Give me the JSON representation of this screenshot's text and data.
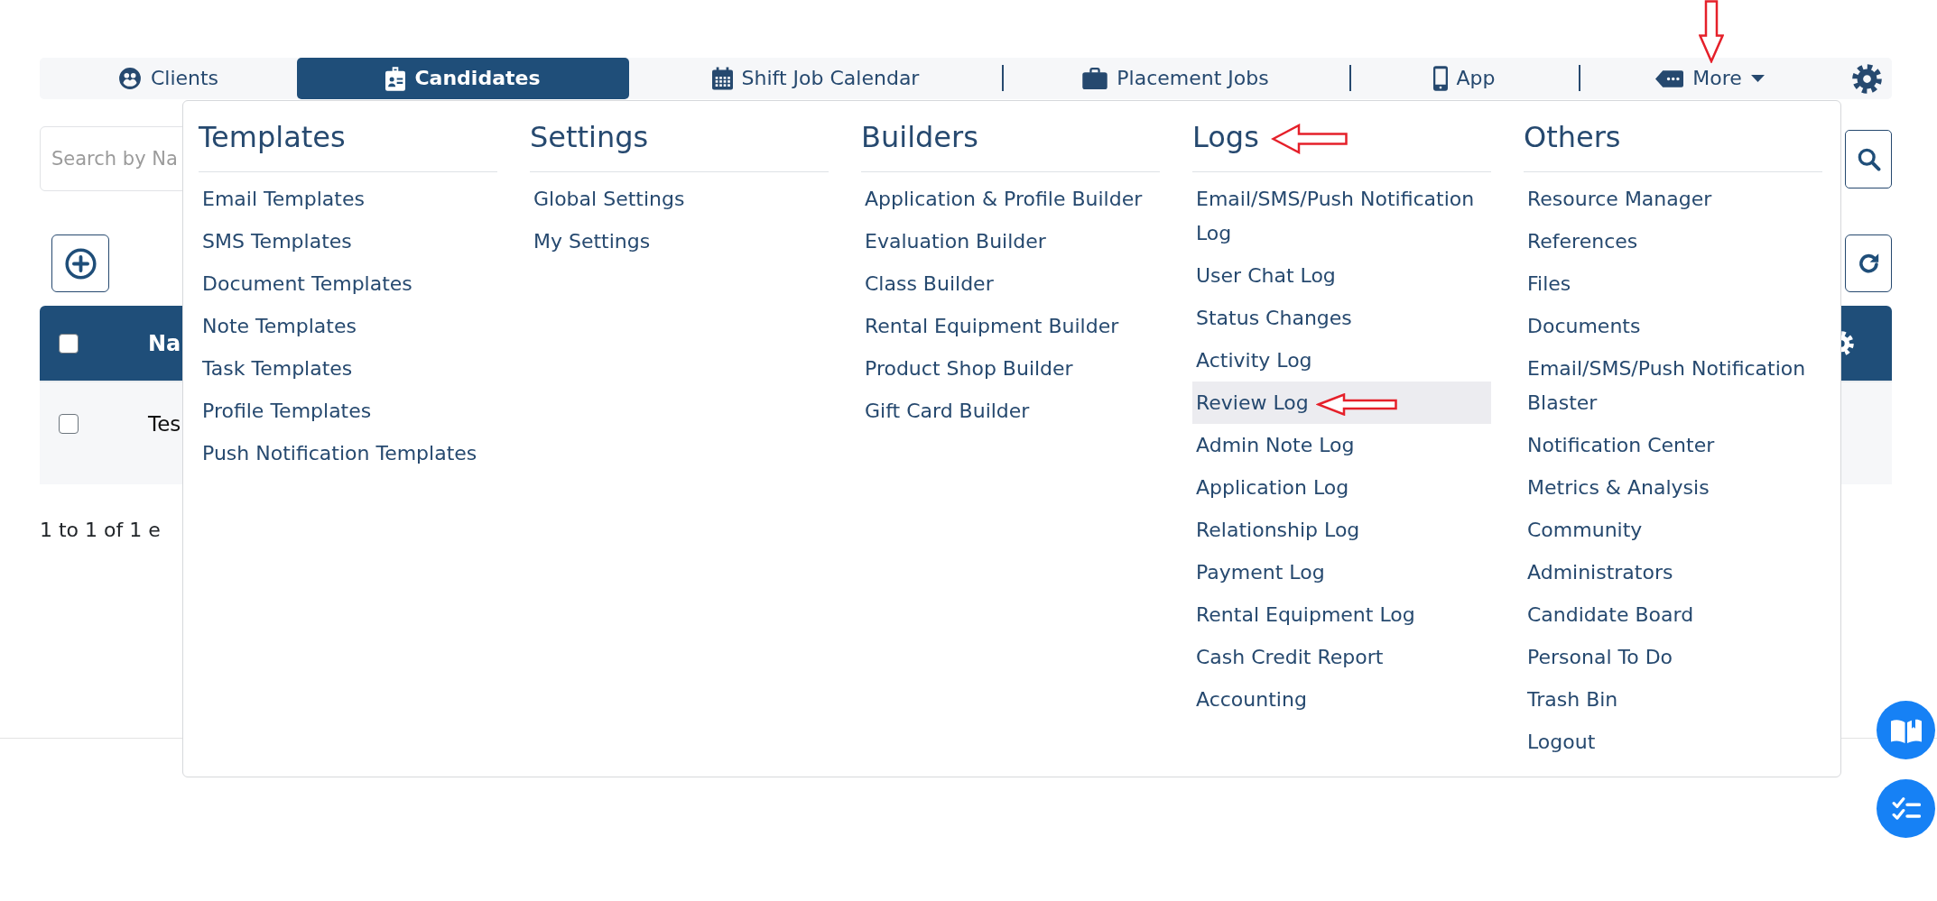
{
  "nav": {
    "tabs": [
      {
        "label": "Clients",
        "kind": "tab",
        "selected": false,
        "arrow": false
      },
      {
        "label": "Candidates",
        "kind": "tab",
        "selected": true,
        "arrow": false
      },
      {
        "label": "Shift Job Calendar",
        "kind": "tab",
        "selected": false,
        "arrow": false
      },
      {
        "label": "Placement Jobs",
        "kind": "tab",
        "selected": false,
        "arrow": false
      },
      {
        "label": "App",
        "kind": "tab",
        "selected": false,
        "arrow": false
      },
      {
        "label": "More",
        "kind": "dropdown",
        "selected": false,
        "expanded": true,
        "arrow": true
      }
    ]
  },
  "search": {
    "placeholder": "Search by Na"
  },
  "table": {
    "select_all": {
      "checked": false
    },
    "columns": [
      {
        "label": "Na"
      }
    ],
    "rows": [
      {
        "checked": false,
        "cells": [
          "Tes"
        ]
      }
    ]
  },
  "summary": "1 to 1 of 1 e",
  "menu": {
    "columns": [
      {
        "title": "Templates",
        "arrow": false,
        "items": [
          {
            "label": "Email Templates",
            "hovered": false,
            "arrow": false
          },
          {
            "label": "SMS Templates",
            "hovered": false,
            "arrow": false
          },
          {
            "label": "Document Templates",
            "hovered": false,
            "arrow": false
          },
          {
            "label": "Note Templates",
            "hovered": false,
            "arrow": false
          },
          {
            "label": "Task Templates",
            "hovered": false,
            "arrow": false
          },
          {
            "label": "Profile Templates",
            "hovered": false,
            "arrow": false
          },
          {
            "label": "Push Notification Templates",
            "hovered": false,
            "arrow": false
          }
        ]
      },
      {
        "title": "Settings",
        "arrow": false,
        "items": [
          {
            "label": "Global Settings",
            "hovered": false,
            "arrow": false
          },
          {
            "label": "My Settings",
            "hovered": false,
            "arrow": false
          }
        ]
      },
      {
        "title": "Builders",
        "arrow": false,
        "items": [
          {
            "label": "Application & Profile Builder",
            "hovered": false,
            "arrow": false
          },
          {
            "label": "Evaluation Builder",
            "hovered": false,
            "arrow": false
          },
          {
            "label": "Class Builder",
            "hovered": false,
            "arrow": false
          },
          {
            "label": "Rental Equipment Builder",
            "hovered": false,
            "arrow": false
          },
          {
            "label": "Product Shop Builder",
            "hovered": false,
            "arrow": false
          },
          {
            "label": "Gift Card Builder",
            "hovered": false,
            "arrow": false
          }
        ]
      },
      {
        "title": "Logs",
        "arrow": true,
        "items": [
          {
            "label": "Email/SMS/Push Notification Log",
            "hovered": false,
            "arrow": false
          },
          {
            "label": "User Chat Log",
            "hovered": false,
            "arrow": false
          },
          {
            "label": "Status Changes",
            "hovered": false,
            "arrow": false
          },
          {
            "label": "Activity Log",
            "hovered": false,
            "arrow": false
          },
          {
            "label": "Review Log",
            "hovered": true,
            "arrow": true
          },
          {
            "label": "Admin Note Log",
            "hovered": false,
            "arrow": false
          },
          {
            "label": "Application Log",
            "hovered": false,
            "arrow": false
          },
          {
            "label": "Relationship Log",
            "hovered": false,
            "arrow": false
          },
          {
            "label": "Payment Log",
            "hovered": false,
            "arrow": false
          },
          {
            "label": "Rental Equipment Log",
            "hovered": false,
            "arrow": false
          },
          {
            "label": "Cash Credit Report",
            "hovered": false,
            "arrow": false
          },
          {
            "label": "Accounting",
            "hovered": false,
            "arrow": false
          }
        ]
      },
      {
        "title": "Others",
        "arrow": false,
        "items": [
          {
            "label": "Resource Manager",
            "hovered": false,
            "arrow": false
          },
          {
            "label": "References",
            "hovered": false,
            "arrow": false
          },
          {
            "label": "Files",
            "hovered": false,
            "arrow": false
          },
          {
            "label": "Documents",
            "hovered": false,
            "arrow": false
          },
          {
            "label": "Email/SMS/Push Notification Blaster",
            "hovered": false,
            "arrow": false
          },
          {
            "label": "Notification Center",
            "hovered": false,
            "arrow": false
          },
          {
            "label": "Metrics & Analysis",
            "hovered": false,
            "arrow": false
          },
          {
            "label": "Community",
            "hovered": false,
            "arrow": false
          },
          {
            "label": "Administrators",
            "hovered": false,
            "arrow": false
          },
          {
            "label": "Candidate Board",
            "hovered": false,
            "arrow": false
          },
          {
            "label": "Personal To Do",
            "hovered": false,
            "arrow": false
          },
          {
            "label": "Trash Bin",
            "hovered": false,
            "arrow": false
          },
          {
            "label": "Logout",
            "hovered": false,
            "arrow": false
          }
        ]
      }
    ]
  }
}
